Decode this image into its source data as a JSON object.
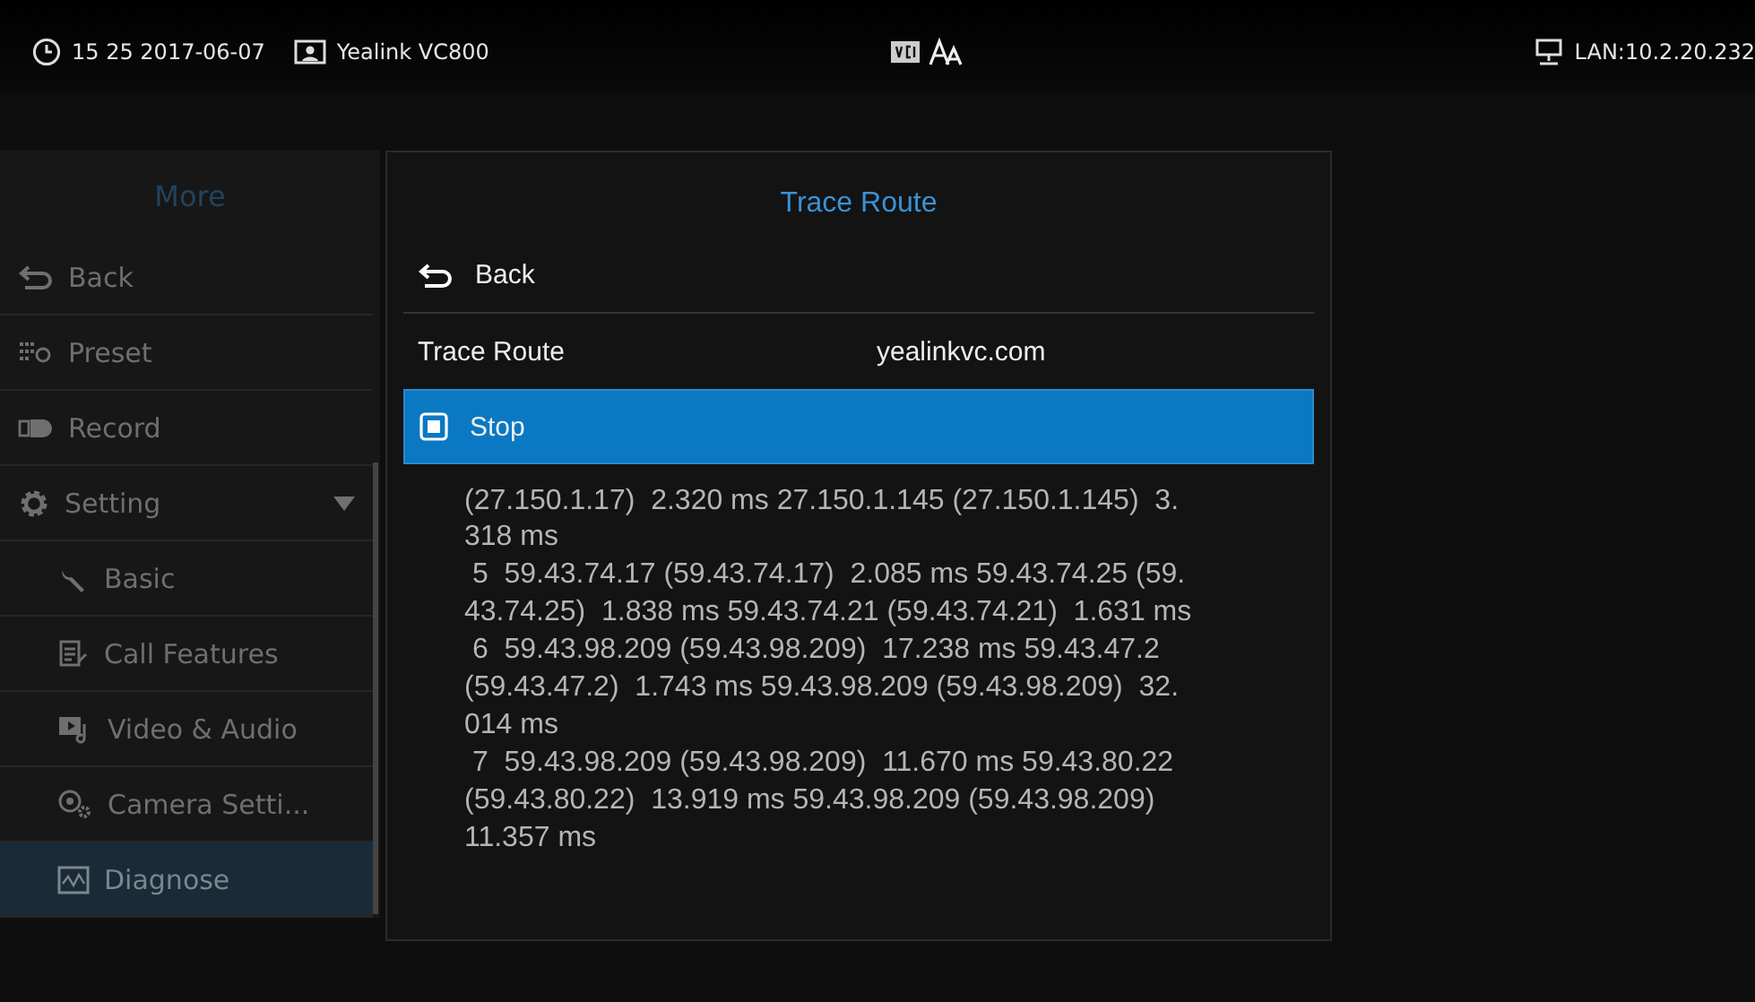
{
  "status_bar": {
    "time": "15 25 2017-06-07",
    "device": "Yealink VC800",
    "network": "LAN:10.2.20.232"
  },
  "sidebar": {
    "title": "More",
    "items": [
      {
        "label": "Back",
        "selected": false
      },
      {
        "label": "Preset",
        "selected": false
      },
      {
        "label": "Record",
        "selected": false
      },
      {
        "label": "Setting",
        "selected": false,
        "expanded": true,
        "children": [
          {
            "label": "Basic",
            "selected": false
          },
          {
            "label": "Call Features",
            "selected": false
          },
          {
            "label": "Video & Audio",
            "selected": false
          },
          {
            "label": "Camera Setti...",
            "selected": false
          },
          {
            "label": "Diagnose",
            "selected": true
          }
        ]
      }
    ]
  },
  "panel": {
    "title": "Trace Route",
    "back": "Back",
    "field_label": "Trace Route",
    "field_value": "yealinkvc.com",
    "action": {
      "label": "Stop",
      "selected": true
    },
    "output": [
      "(27.150.1.17)  2.320 ms 27.150.1.145 (27.150.1.145)  3.",
      "318 ms",
      " 5  59.43.74.17 (59.43.74.17)  2.085 ms 59.43.74.25 (59.",
      "43.74.25)  1.838 ms 59.43.74.21 (59.43.74.21)  1.631 ms",
      " 6  59.43.98.209 (59.43.98.209)  17.238 ms 59.43.47.2",
      "(59.43.47.2)  1.743 ms 59.43.98.209 (59.43.98.209)  32.",
      "014 ms",
      " 7  59.43.98.209 (59.43.98.209)  11.670 ms 59.43.80.22",
      "(59.43.80.22)  13.919 ms 59.43.98.209 (59.43.98.209)",
      "11.357 ms"
    ]
  }
}
